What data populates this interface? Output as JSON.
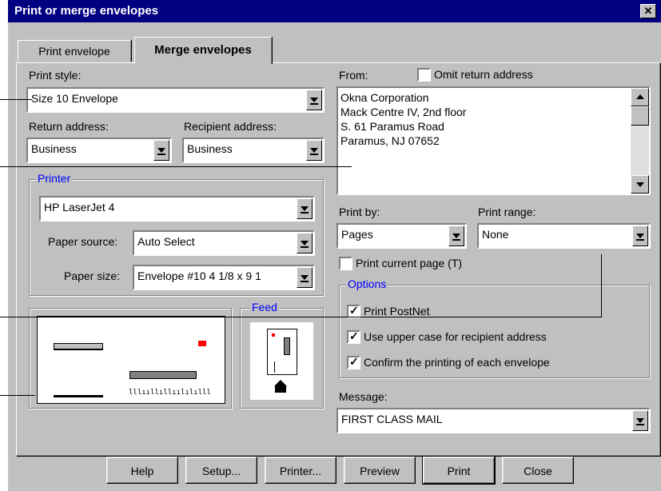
{
  "dialog": {
    "title": "Print or merge envelopes",
    "close_glyph": "✕"
  },
  "tabs": [
    {
      "label": "Print envelope"
    },
    {
      "label": "Merge envelopes"
    }
  ],
  "print_style": {
    "label": "Print style:",
    "value": "Size 10 Envelope"
  },
  "return_address": {
    "label": "Return address:",
    "value": "Business"
  },
  "recipient_address": {
    "label": "Recipient address:",
    "value": "Business"
  },
  "printer_group": {
    "label": "Printer",
    "printer": "HP LaserJet 4",
    "paper_source_label": "Paper source:",
    "paper_source": "Auto Select",
    "paper_size_label": "Paper size:",
    "paper_size": "Envelope #10 4 1/8 x 9 1"
  },
  "feed": {
    "label": "Feed"
  },
  "preview": {
    "barcode_text": "lllııllıllıılılılll"
  },
  "from": {
    "label": "From:",
    "omit_label": "Omit return address",
    "omit_checked": false,
    "lines": [
      "Okna Corporation",
      "Mack Centre IV, 2nd floor",
      "S. 61 Paramus Road",
      "Paramus, NJ 07652"
    ]
  },
  "print_by": {
    "label": "Print by:",
    "value": "Pages"
  },
  "print_range": {
    "label": "Print range:",
    "value": "None"
  },
  "print_current": {
    "label": "Print current page (T)",
    "checked": false
  },
  "options": {
    "label": "Options",
    "items": [
      {
        "label": "Print PostNet",
        "checked": true
      },
      {
        "label": "Use upper case for recipient address",
        "checked": true
      },
      {
        "label": "Confirm the printing of each envelope",
        "checked": true
      }
    ]
  },
  "message": {
    "label": "Message:",
    "value": "FIRST CLASS MAIL"
  },
  "buttons": [
    "Help",
    "Setup...",
    "Printer...",
    "Preview",
    "Print",
    "Close"
  ],
  "colors": {
    "title_bg": "#000080",
    "face": "#c0c0c0",
    "group_label": "#0000ff",
    "stamp": "#ff0000"
  }
}
